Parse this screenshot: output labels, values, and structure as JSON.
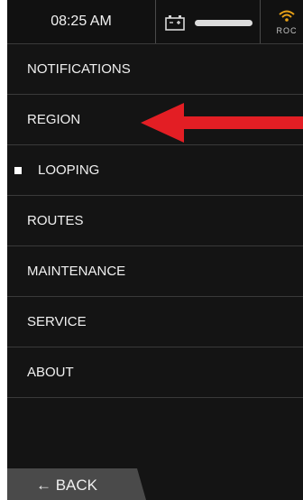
{
  "status_bar": {
    "time": "08:25 AM",
    "battery_icon": "battery-icon",
    "wifi_icon": "wifi-signal-icon",
    "network_label": "ROC"
  },
  "menu": {
    "items": [
      {
        "label": "NOTIFICATIONS",
        "selected": false
      },
      {
        "label": "REGION",
        "selected": false
      },
      {
        "label": "LOOPING",
        "selected": true
      },
      {
        "label": "ROUTES",
        "selected": false
      },
      {
        "label": "MAINTENANCE",
        "selected": false
      },
      {
        "label": "SERVICE",
        "selected": false
      },
      {
        "label": "ABOUT",
        "selected": false
      }
    ]
  },
  "back_button": {
    "label": "← BACK"
  },
  "colors": {
    "background": "#141414",
    "text": "#f0f0f0",
    "divider": "#3a3a3a",
    "back_tab": "#4a4a4a",
    "accent_wifi": "#e8a117",
    "annotation_arrow": "#e31e24"
  }
}
